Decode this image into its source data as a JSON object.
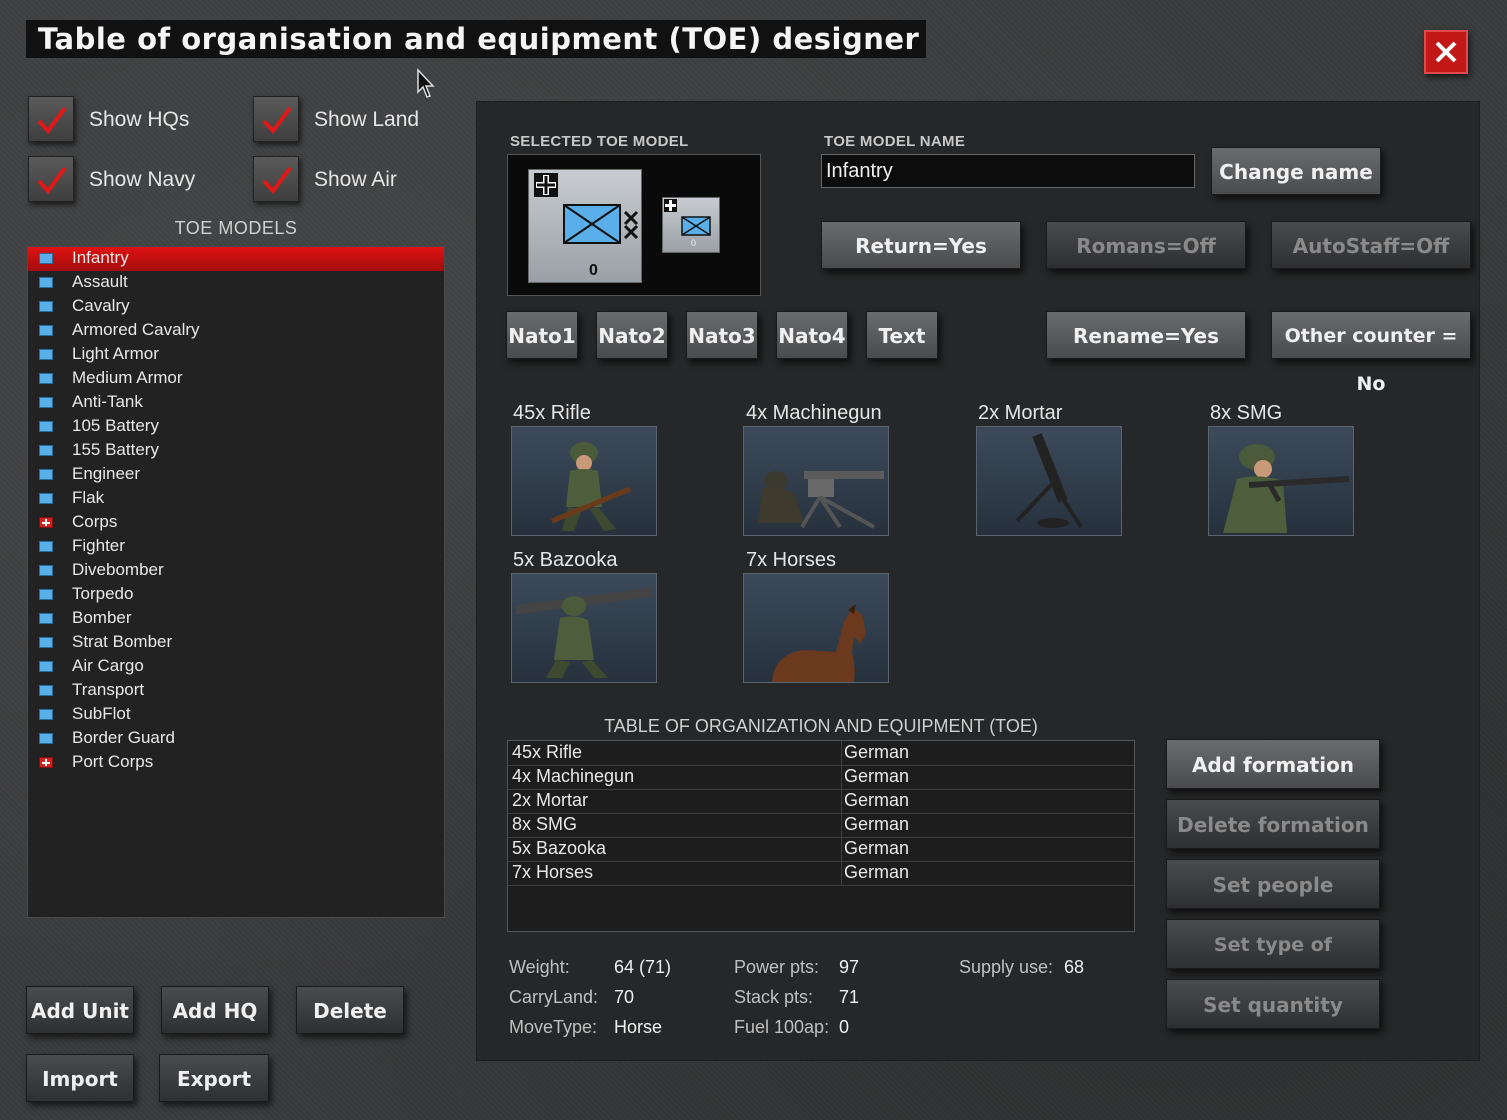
{
  "window": {
    "title": "Table of organisation and equipment (TOE) designer",
    "close_label": "close"
  },
  "filters": {
    "show_hqs": "Show HQs",
    "show_land": "Show Land",
    "show_navy": "Show Navy",
    "show_air": "Show Air"
  },
  "models": {
    "title": "TOE MODELS",
    "selected": "Infantry",
    "items": [
      {
        "label": "Infantry",
        "icon": "blue"
      },
      {
        "label": "Assault",
        "icon": "blue"
      },
      {
        "label": "Cavalry",
        "icon": "blue"
      },
      {
        "label": "Armored Cavalry",
        "icon": "blue"
      },
      {
        "label": "Light Armor",
        "icon": "blue"
      },
      {
        "label": "Medium Armor",
        "icon": "blue"
      },
      {
        "label": "Anti-Tank",
        "icon": "blue"
      },
      {
        "label": "105 Battery",
        "icon": "blue"
      },
      {
        "label": "155 Battery",
        "icon": "blue"
      },
      {
        "label": "Engineer",
        "icon": "blue"
      },
      {
        "label": "Flak",
        "icon": "blue"
      },
      {
        "label": "Corps",
        "icon": "red"
      },
      {
        "label": "Fighter",
        "icon": "blue"
      },
      {
        "label": "Divebomber",
        "icon": "blue"
      },
      {
        "label": "Torpedo",
        "icon": "blue"
      },
      {
        "label": "Bomber",
        "icon": "blue"
      },
      {
        "label": "Strat Bomber",
        "icon": "blue"
      },
      {
        "label": "Air Cargo",
        "icon": "blue"
      },
      {
        "label": "Transport",
        "icon": "blue"
      },
      {
        "label": "SubFlot",
        "icon": "blue"
      },
      {
        "label": "Border Guard",
        "icon": "blue"
      },
      {
        "label": "Port Corps",
        "icon": "red"
      }
    ]
  },
  "bottom_buttons": {
    "add_unit": "Add Unit",
    "add_hq": "Add HQ",
    "delete": "Delete",
    "import": "Import",
    "export": "Export"
  },
  "detail": {
    "selected_label": "SELECTED TOE MODEL",
    "name_label": "TOE MODEL NAME",
    "name_value": "Infantry",
    "change_name": "Change name",
    "counter_big_value": "0",
    "counter_small_value": "0",
    "return": "Return=Yes",
    "romans": "Romans=Off",
    "autostaff": "AutoStaff=Off",
    "nato1": "Nato1",
    "nato2": "Nato2",
    "nato3": "Nato3",
    "nato4": "Nato4",
    "text": "Text",
    "rename": "Rename=Yes",
    "other_counter": "Other counter = No"
  },
  "equipment": [
    {
      "label": "45x Rifle",
      "icon": "rifleman-icon"
    },
    {
      "label": "4x Machinegun",
      "icon": "machinegun-icon"
    },
    {
      "label": "2x Mortar",
      "icon": "mortar-icon"
    },
    {
      "label": "8x SMG",
      "icon": "smg-icon"
    },
    {
      "label": "5x Bazooka",
      "icon": "bazooka-icon"
    },
    {
      "label": "7x Horses",
      "icon": "horse-icon"
    }
  ],
  "toe_table": {
    "title": "TABLE OF ORGANIZATION AND EQUIPMENT (TOE)",
    "rows": [
      {
        "item": "45x Rifle",
        "nation": "German"
      },
      {
        "item": "4x Machinegun",
        "nation": "German"
      },
      {
        "item": "2x Mortar",
        "nation": "German"
      },
      {
        "item": "8x SMG",
        "nation": "German"
      },
      {
        "item": "5x Bazooka",
        "nation": "German"
      },
      {
        "item": "7x Horses",
        "nation": "German"
      }
    ]
  },
  "formation_buttons": {
    "add": "Add formation",
    "delete": "Delete formation",
    "people": "Set people",
    "type": "Set type of formation",
    "quantity": "Set quantity"
  },
  "stats": {
    "weight_label": "Weight:",
    "weight": "64 (71)",
    "carry_label": "CarryLand:",
    "carry": "70",
    "move_label": "MoveType:",
    "move": "Horse",
    "power_label": "Power pts:",
    "power": "97",
    "stack_label": "Stack pts:",
    "stack": "71",
    "fuel_label": "Fuel 100ap:",
    "fuel": "0",
    "supply_label": "Supply use:",
    "supply": "68"
  },
  "colors": {
    "selection": "#d01010",
    "panel": "#262728",
    "unit_icon": "#5aaeea"
  }
}
